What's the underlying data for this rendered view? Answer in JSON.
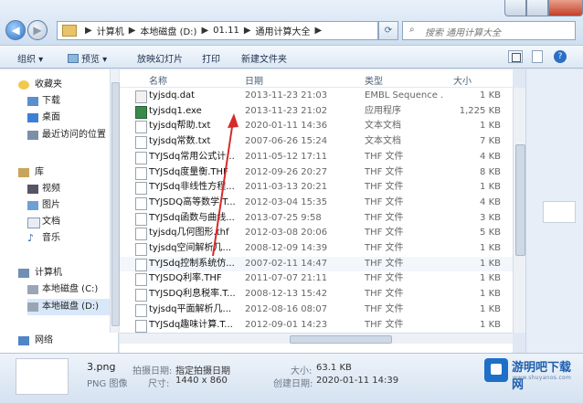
{
  "window": {
    "minimize_icon": "minimize-icon",
    "maximize_icon": "maximize-icon",
    "close_icon": "close-icon",
    "accent": "#c4402a"
  },
  "address_bar": {
    "crumbs": [
      "计算机",
      "本地磁盘 (D:)",
      "01.11",
      "通用计算大全"
    ],
    "search_placeholder": "搜索 通用计算大全"
  },
  "toolbar": {
    "organize": "组织 ▾",
    "preview": "预览 ▾",
    "slideshow": "放映幻灯片",
    "print": "打印",
    "new_folder": "新建文件夹"
  },
  "nav": {
    "favorites": "收藏夹",
    "downloads": "下载",
    "desktop": "桌面",
    "recent": "最近访问的位置",
    "libraries": "库",
    "videos": "视频",
    "pictures": "图片",
    "documents": "文档",
    "music": "音乐",
    "computer": "计算机",
    "drive_c": "本地磁盘 (C:)",
    "drive_d": "本地磁盘 (D:)",
    "network": "网络"
  },
  "columns": {
    "name": "名称",
    "date": "日期",
    "type": "类型",
    "size": "大小"
  },
  "files": [
    {
      "name": "tyjsdq.dat",
      "date": "2013-11-23 21:03",
      "type": "EMBL Sequence ...",
      "size": "1 KB",
      "icon": "dat"
    },
    {
      "name": "tyjsdq1.exe",
      "date": "2013-11-23 21:02",
      "type": "应用程序",
      "size": "1,225 KB",
      "icon": "exe"
    },
    {
      "name": "tyjsdq帮助.txt",
      "date": "2020-01-11 14:36",
      "type": "文本文档",
      "size": "1 KB",
      "icon": "txt"
    },
    {
      "name": "tyjsdq常数.txt",
      "date": "2007-06-26 15:24",
      "type": "文本文档",
      "size": "7 KB",
      "icon": "txt"
    },
    {
      "name": "TYJSdq常用公式计...",
      "date": "2011-05-12 17:11",
      "type": "THF 文件",
      "size": "4 KB",
      "icon": "thf"
    },
    {
      "name": "TYJSdq度量衡.THF",
      "date": "2012-09-26 20:27",
      "type": "THF 文件",
      "size": "8 KB",
      "icon": "thf"
    },
    {
      "name": "TYJSdq非线性方程...",
      "date": "2011-03-13 20:21",
      "type": "THF 文件",
      "size": "1 KB",
      "icon": "thf"
    },
    {
      "name": "TYJSDQ高等数学.T...",
      "date": "2012-03-04 15:35",
      "type": "THF 文件",
      "size": "4 KB",
      "icon": "thf"
    },
    {
      "name": "TYJSdq函数与曲线...",
      "date": "2013-07-25 9:58",
      "type": "THF 文件",
      "size": "3 KB",
      "icon": "thf"
    },
    {
      "name": "tyjsdq几何图形.thf",
      "date": "2012-03-08 20:06",
      "type": "THF 文件",
      "size": "5 KB",
      "icon": "thf"
    },
    {
      "name": "tyjsdq空间解析几...",
      "date": "2008-12-09 14:39",
      "type": "THF 文件",
      "size": "1 KB",
      "icon": "thf"
    },
    {
      "name": "TYJSdq控制系统仿...",
      "date": "2007-02-11 14:47",
      "type": "THF 文件",
      "size": "1 KB",
      "icon": "thf"
    },
    {
      "name": "TYJSDQ利率.THF",
      "date": "2011-07-07 21:11",
      "type": "THF 文件",
      "size": "1 KB",
      "icon": "thf"
    },
    {
      "name": "TYJSDQ利息税率.T...",
      "date": "2008-12-13 15:42",
      "type": "THF 文件",
      "size": "1 KB",
      "icon": "thf"
    },
    {
      "name": "tyjsdq平面解析几...",
      "date": "2012-08-16 08:07",
      "type": "THF 文件",
      "size": "1 KB",
      "icon": "thf"
    },
    {
      "name": "TYJSdq趣味计算.T...",
      "date": "2012-09-01 14:23",
      "type": "THF 文件",
      "size": "1 KB",
      "icon": "thf"
    }
  ],
  "details": {
    "filename": "3.png",
    "filetype": "PNG 图像",
    "date_taken_label": "拍摄日期:",
    "date_taken_value": "指定拍摄日期",
    "dimensions_label": "尺寸:",
    "dimensions_value": "1440 x 860",
    "size_label": "大小:",
    "size_value": "63.1 KB",
    "created_label": "创建日期:",
    "created_value": "2020-01-11 14:39"
  },
  "watermark": {
    "text": "游明吧下载网",
    "sub": "www.shuyanos.com",
    "color": "#1d5fae"
  }
}
